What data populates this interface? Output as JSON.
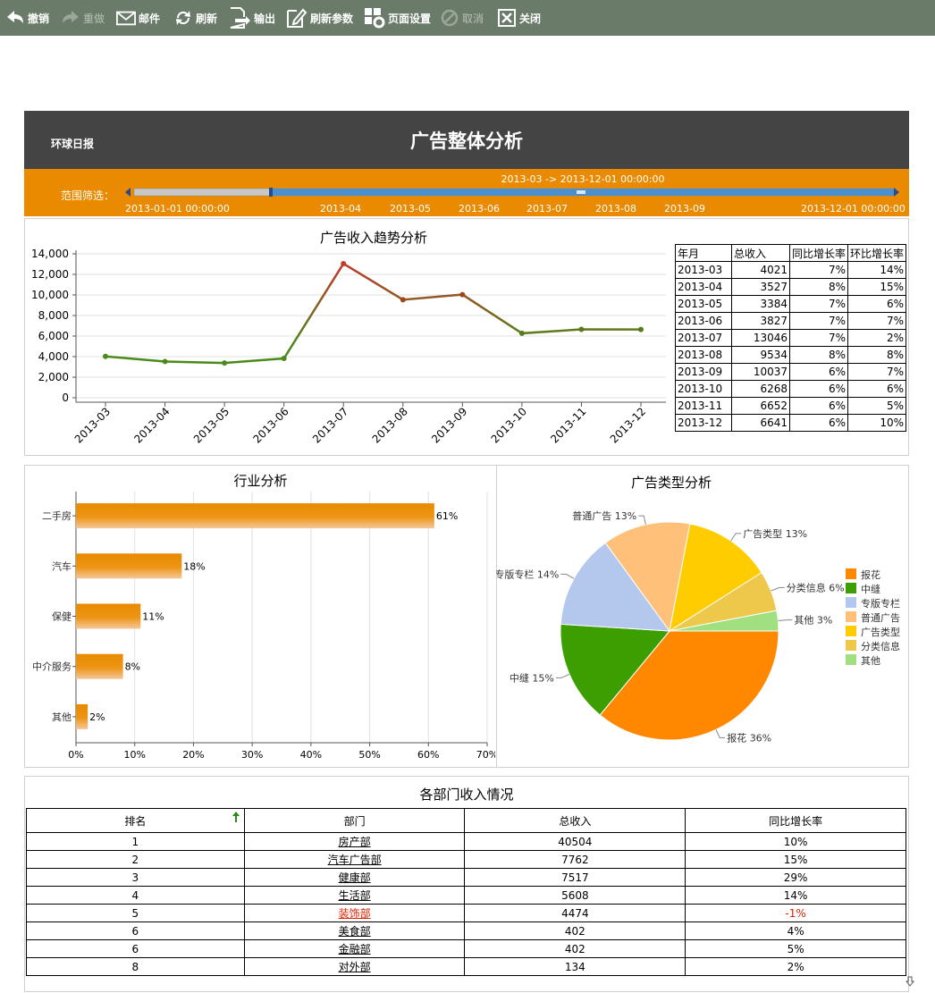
{
  "toolbar": {
    "items": [
      {
        "label": "撤销",
        "icon": "undo-icon",
        "enabled": true
      },
      {
        "label": "重做",
        "icon": "redo-icon",
        "enabled": false
      },
      {
        "label": "邮件",
        "icon": "mail-icon",
        "enabled": true
      },
      {
        "label": "刷新",
        "icon": "refresh-icon",
        "enabled": true
      },
      {
        "label": "输出",
        "icon": "export-icon",
        "enabled": true
      },
      {
        "label": "刷新参数",
        "icon": "edit-params-icon",
        "enabled": true
      },
      {
        "label": "页面设置",
        "icon": "page-setup-icon",
        "enabled": true
      },
      {
        "label": "取消",
        "icon": "cancel-icon",
        "enabled": false
      },
      {
        "label": "关闭",
        "icon": "close-icon",
        "enabled": true
      }
    ]
  },
  "header": {
    "brand": "环球日报",
    "title": "广告整体分析"
  },
  "range_filter": {
    "label": "范围筛选：",
    "current": "2013-03 -> 2013-12-01 00:00:00",
    "start_label": "2013-01-01 00:00:00",
    "end_label": "2013-12-01 00:00:00",
    "ticks": [
      "2013-04",
      "2013-05",
      "2013-06",
      "2013-07",
      "2013-08",
      "2013-09"
    ],
    "selected_fraction": [
      0.18,
      1.0
    ]
  },
  "trend": {
    "title": "广告收入趋势分析",
    "table_headers": [
      "年月",
      "总收入",
      "同比增长率",
      "环比增长率"
    ],
    "rows": [
      [
        "2013-03",
        "4021",
        "7%",
        "14%"
      ],
      [
        "2013-04",
        "3527",
        "8%",
        "15%"
      ],
      [
        "2013-05",
        "3384",
        "7%",
        "6%"
      ],
      [
        "2013-06",
        "3827",
        "7%",
        "7%"
      ],
      [
        "2013-07",
        "13046",
        "7%",
        "2%"
      ],
      [
        "2013-08",
        "9534",
        "8%",
        "8%"
      ],
      [
        "2013-09",
        "10037",
        "6%",
        "7%"
      ],
      [
        "2013-10",
        "6268",
        "6%",
        "6%"
      ],
      [
        "2013-11",
        "6652",
        "6%",
        "5%"
      ],
      [
        "2013-12",
        "6641",
        "6%",
        "10%"
      ]
    ]
  },
  "industry": {
    "title": "行业分析"
  },
  "adtype": {
    "title": "广告类型分析"
  },
  "dept": {
    "title": "各部门收入情况",
    "headers": [
      "排名",
      "部门",
      "总收入",
      "同比增长率"
    ],
    "rows": [
      {
        "rank": "1",
        "name": "房产部",
        "total": "40504",
        "rate": "10%"
      },
      {
        "rank": "2",
        "name": "汽车广告部",
        "total": "7762",
        "rate": "15%"
      },
      {
        "rank": "3",
        "name": "健康部",
        "total": "7517",
        "rate": "29%"
      },
      {
        "rank": "4",
        "name": "生活部",
        "total": "5608",
        "rate": "14%"
      },
      {
        "rank": "5",
        "name": "装饰部",
        "total": "4474",
        "rate": "-1%"
      },
      {
        "rank": "6",
        "name": "美食部",
        "total": "402",
        "rate": "4%"
      },
      {
        "rank": "6",
        "name": "金融部",
        "total": "402",
        "rate": "5%"
      },
      {
        "rank": "8",
        "name": "对外部",
        "total": "134",
        "rate": "2%"
      }
    ]
  },
  "colors": {
    "toolbar_bg": "#6a7b6a",
    "header_bg": "#444444",
    "range_bg": "#ea8a00",
    "bar": "#e88a00",
    "line_green": "#4a8a1a",
    "line_red": "#c0392b",
    "negative": "#dd2200"
  },
  "chart_data": [
    {
      "type": "line",
      "title": "广告收入趋势分析",
      "x": [
        "2013-03",
        "2013-04",
        "2013-05",
        "2013-06",
        "2013-07",
        "2013-08",
        "2013-09",
        "2013-10",
        "2013-11",
        "2013-12"
      ],
      "values": [
        4021,
        3527,
        3384,
        3827,
        13046,
        9534,
        10037,
        6268,
        6652,
        6641
      ],
      "ylim": [
        0,
        14000
      ],
      "yticks": [
        "0",
        "2,000",
        "4,000",
        "6,000",
        "8,000",
        "10,000",
        "12,000",
        "14,000"
      ],
      "grid": true
    },
    {
      "type": "bar",
      "orientation": "horizontal",
      "title": "行业分析",
      "categories": [
        "二手房",
        "汽车",
        "保健",
        "中介服务",
        "其他"
      ],
      "values": [
        61,
        18,
        11,
        8,
        2
      ],
      "labels": [
        "61%",
        "18%",
        "11%",
        "8%",
        "2%"
      ],
      "xlim": [
        0,
        70
      ],
      "xticks": [
        "0%",
        "10%",
        "20%",
        "30%",
        "40%",
        "50%",
        "60%",
        "70%"
      ],
      "grid": true
    },
    {
      "type": "pie",
      "title": "广告类型分析",
      "slices": [
        {
          "name": "报花",
          "value": 36,
          "label": "36%",
          "color": "#ff8800"
        },
        {
          "name": "中缝",
          "value": 15,
          "label": "15%",
          "color": "#3c9e00"
        },
        {
          "name": "专版专栏",
          "value": 14,
          "label": "14%",
          "color": "#b4c8ee"
        },
        {
          "name": "普通广告",
          "value": 13,
          "label": "13%",
          "color": "#ffc07a"
        },
        {
          "name": "广告类型",
          "value": 13,
          "label": "13%",
          "color": "#ffcc00"
        },
        {
          "name": "分类信息",
          "value": 6,
          "label": "6%",
          "color": "#eec84a"
        },
        {
          "name": "其他",
          "value": 3,
          "label": "3%",
          "color": "#a0e080"
        }
      ],
      "legend": "right"
    }
  ]
}
